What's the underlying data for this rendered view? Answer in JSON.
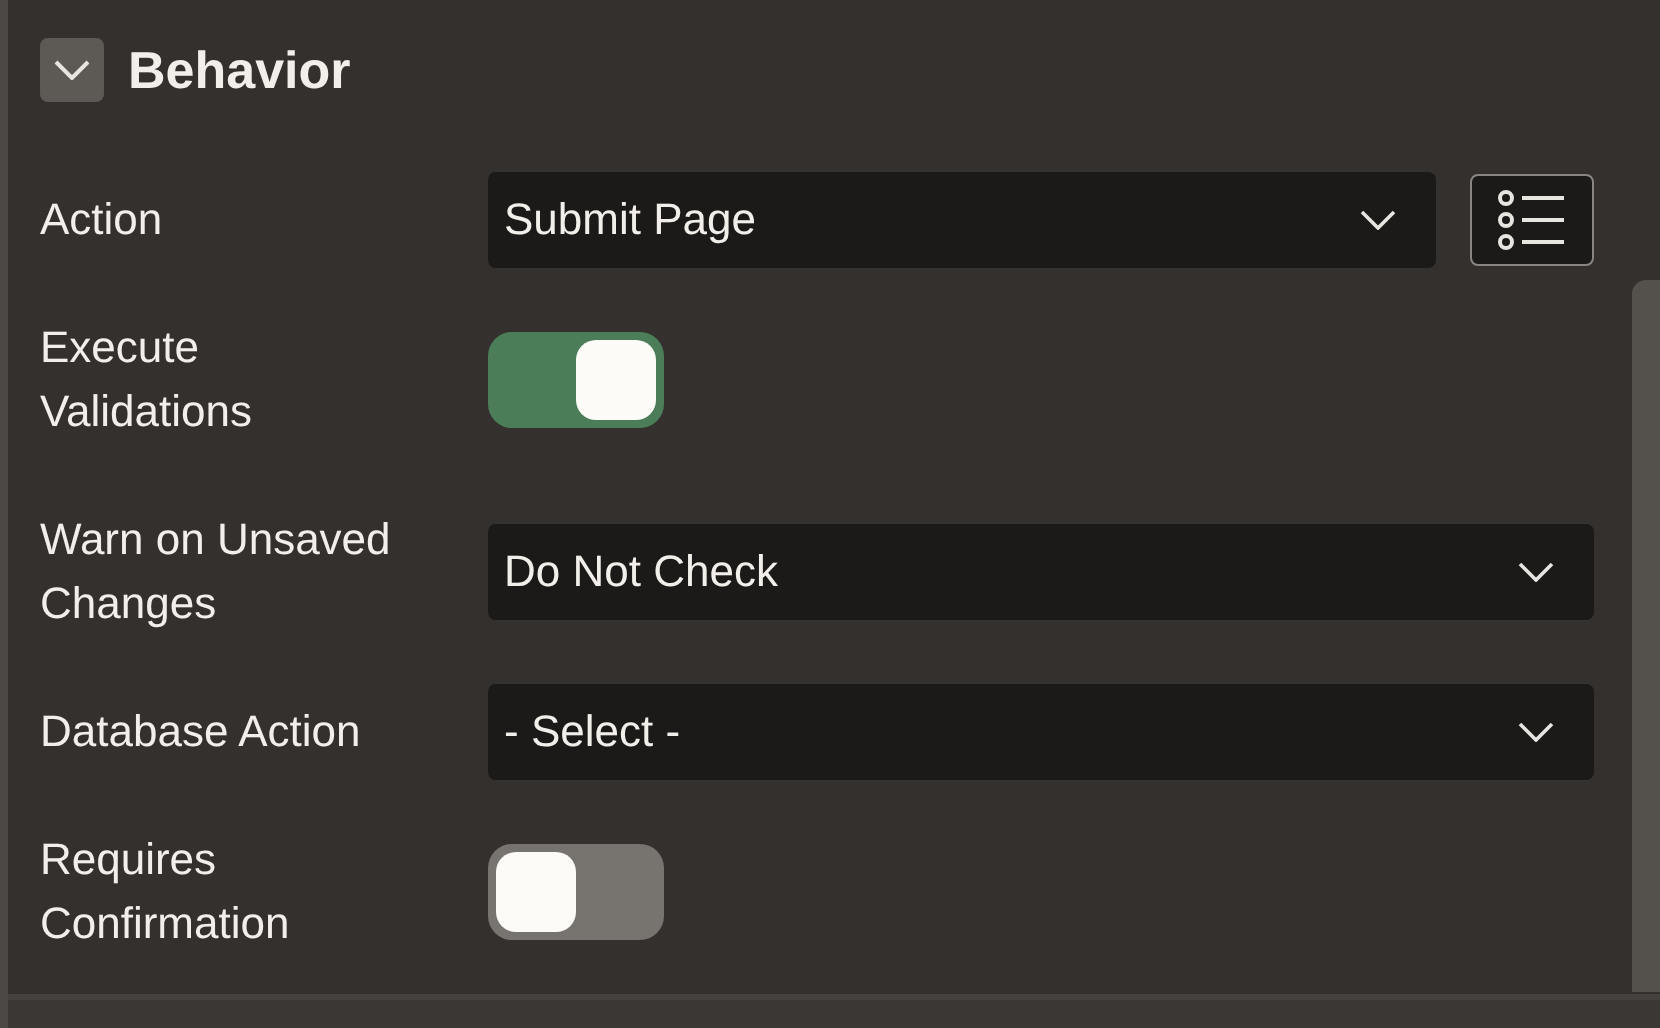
{
  "section": {
    "title": "Behavior",
    "expanded": true
  },
  "fields": [
    {
      "kind": "select",
      "label": "Action",
      "value": "Submit Page",
      "list_button": true
    },
    {
      "kind": "toggle",
      "label": "Execute Validations",
      "on": true
    },
    {
      "kind": "select",
      "label": "Warn on Unsaved Changes",
      "value": "Do Not Check",
      "list_button": false
    },
    {
      "kind": "select",
      "label": "Database Action",
      "value": "- Select -",
      "list_button": false
    },
    {
      "kind": "toggle",
      "label": "Requires Confirmation",
      "on": false
    }
  ]
}
